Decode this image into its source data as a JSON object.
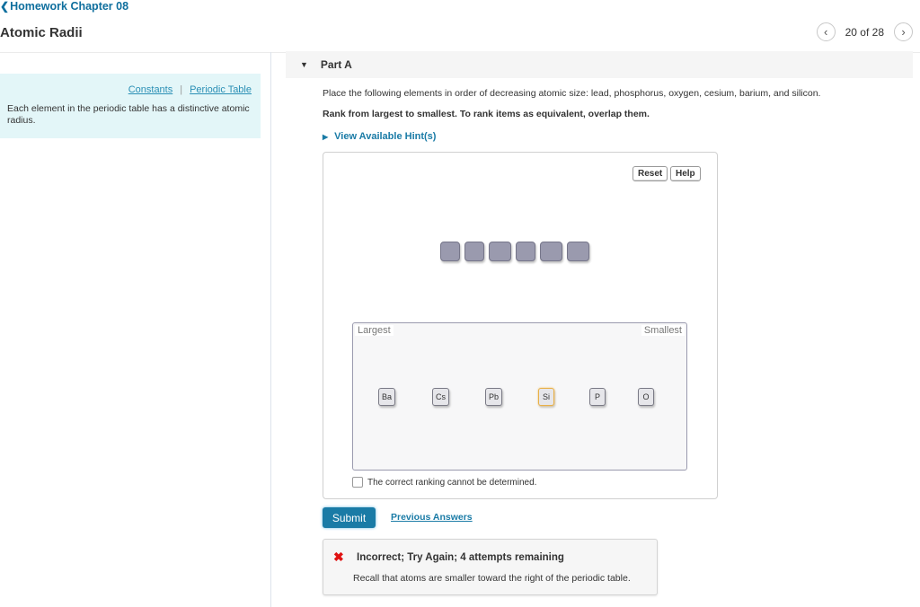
{
  "nav": {
    "back_label": "Homework Chapter 08",
    "page_title": "Atomic Radii",
    "pager_text": "20 of 28",
    "prev_icon": "‹",
    "next_icon": "›"
  },
  "intro": {
    "links": [
      "Constants",
      "Periodic Table"
    ],
    "separator": "|",
    "text": "Each element in the periodic table has a distinctive atomic radius."
  },
  "part": {
    "label": "Part A",
    "question": "Place the following elements in order of decreasing atomic size: lead, phosphorus, oxygen, cesium, barium, and silicon.",
    "instructions": "Rank from largest to smallest. To rank items as equivalent, overlap them.",
    "hint_label": "View Available Hint(s)"
  },
  "widget": {
    "reset_label": "Reset",
    "help_label": "Help",
    "empty_slot_count": 6,
    "largest_label": "Largest",
    "smallest_label": "Smallest",
    "chips": [
      {
        "label": "Ba",
        "selected": false
      },
      {
        "label": "Cs",
        "selected": false
      },
      {
        "label": "Pb",
        "selected": false
      },
      {
        "label": "Si",
        "selected": true
      },
      {
        "label": "P",
        "selected": false
      },
      {
        "label": "O",
        "selected": false
      }
    ],
    "cannot_determine_label": "The correct ranking cannot be determined.",
    "cannot_determine_checked": false
  },
  "actions": {
    "submit_label": "Submit",
    "previous_answers_label": "Previous Answers"
  },
  "feedback": {
    "icon": "✖",
    "title": "Incorrect; Try Again; 4 attempts remaining",
    "message": "Recall that atoms are smaller toward the right of the periodic table.",
    "color": "#e01212"
  },
  "colors": {
    "accent": "#1a7ba6",
    "intro_bg": "#e3f6f8",
    "slot_fill": "#9a9aae",
    "selected_outline": "#e8b048"
  }
}
